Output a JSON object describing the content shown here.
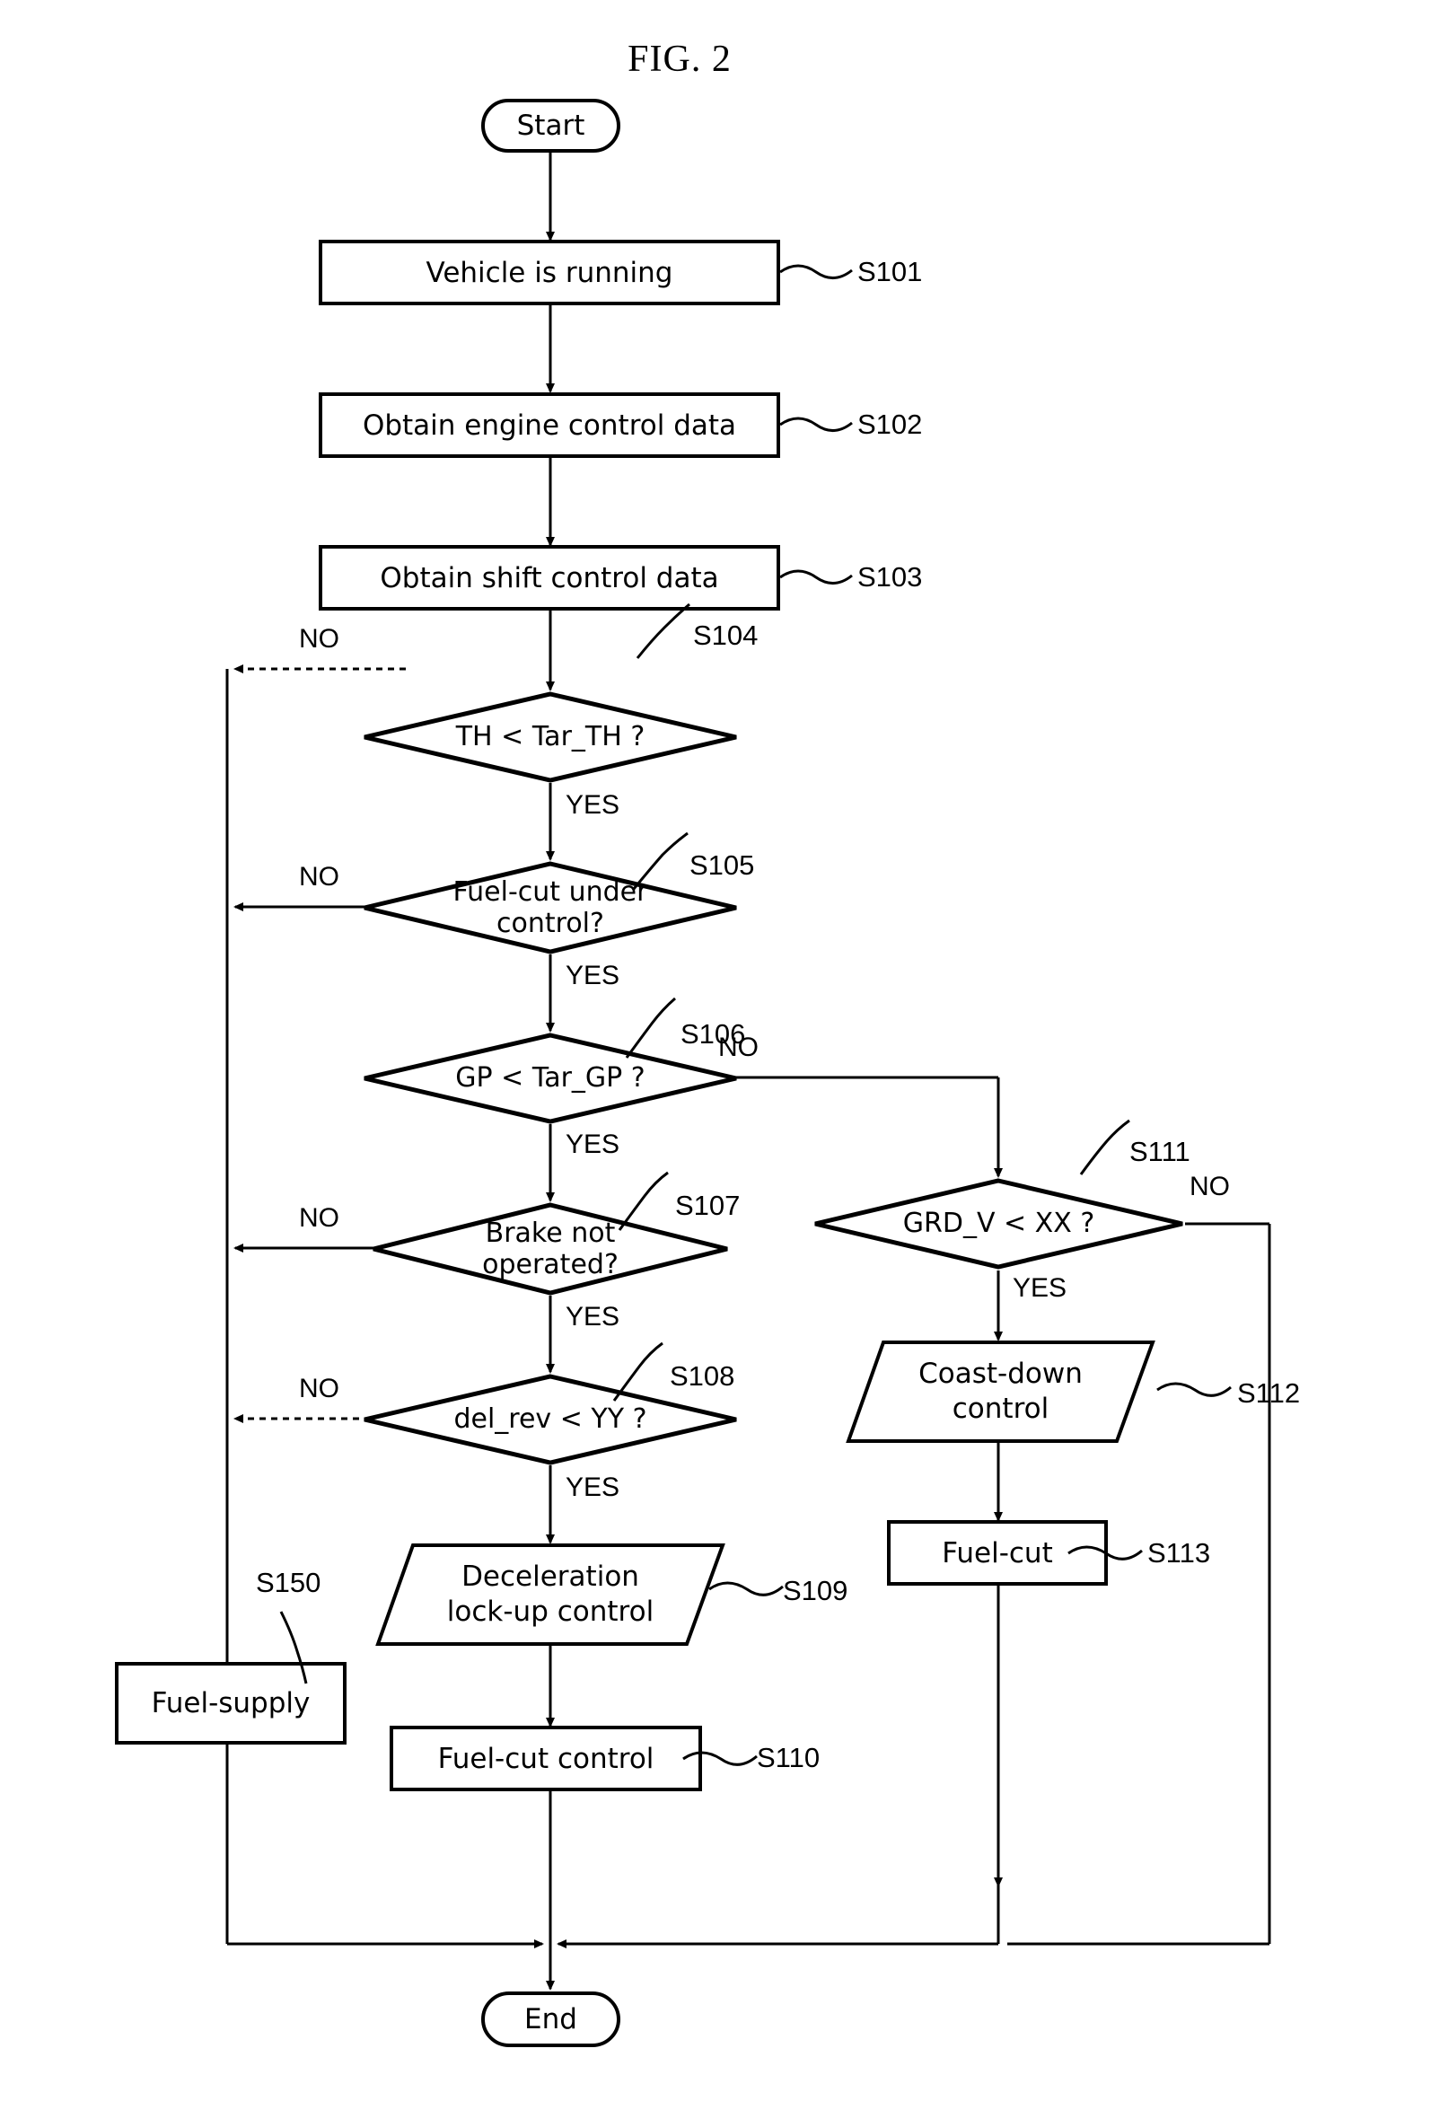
{
  "figure": {
    "title": "FIG. 2"
  },
  "nodes": {
    "start": {
      "label": "Start",
      "type": "terminator"
    },
    "s101": {
      "label": "Vehicle is running",
      "step": "S101",
      "type": "process"
    },
    "s102": {
      "label": "Obtain engine control data",
      "step": "S102",
      "type": "process"
    },
    "s103": {
      "label": "Obtain shift control data",
      "step": "S103",
      "type": "process"
    },
    "s104": {
      "label": "TH < Tar_TH ?",
      "step": "S104",
      "type": "decision"
    },
    "s105a": {
      "label": "Fuel-cut under",
      "step": "S105",
      "type": "decision"
    },
    "s105b": {
      "label": "control?"
    },
    "s106": {
      "label": "GP < Tar_GP ?",
      "step": "S106",
      "type": "decision"
    },
    "s107a": {
      "label": "Brake not",
      "step": "S107",
      "type": "decision"
    },
    "s107b": {
      "label": "operated?"
    },
    "s108": {
      "label": "del_rev < YY ?",
      "step": "S108",
      "type": "decision"
    },
    "s109a": {
      "label": "Deceleration",
      "step": "S109",
      "type": "parallelogram"
    },
    "s109b": {
      "label": "lock-up control"
    },
    "s110": {
      "label": "Fuel-cut control",
      "step": "S110",
      "type": "process"
    },
    "s111": {
      "label": "GRD_V < XX ?",
      "step": "S111",
      "type": "decision"
    },
    "s112a": {
      "label": "Coast-down",
      "step": "S112",
      "type": "parallelogram"
    },
    "s112b": {
      "label": "control"
    },
    "s113": {
      "label": "Fuel-cut",
      "step": "S113",
      "type": "process"
    },
    "s150": {
      "label": "Fuel-supply",
      "step": "S150",
      "type": "process"
    },
    "end": {
      "label": "End",
      "type": "terminator"
    }
  },
  "branches": {
    "no104": "NO",
    "yes104": "YES",
    "no105": "NO",
    "yes105": "YES",
    "no106": "NO",
    "yes106": "YES",
    "no107": "NO",
    "yes107": "YES",
    "no108": "NO",
    "yes108": "YES",
    "no111": "NO",
    "yes111": "YES"
  },
  "colors": {
    "stroke": "#000000",
    "background": "#ffffff"
  }
}
